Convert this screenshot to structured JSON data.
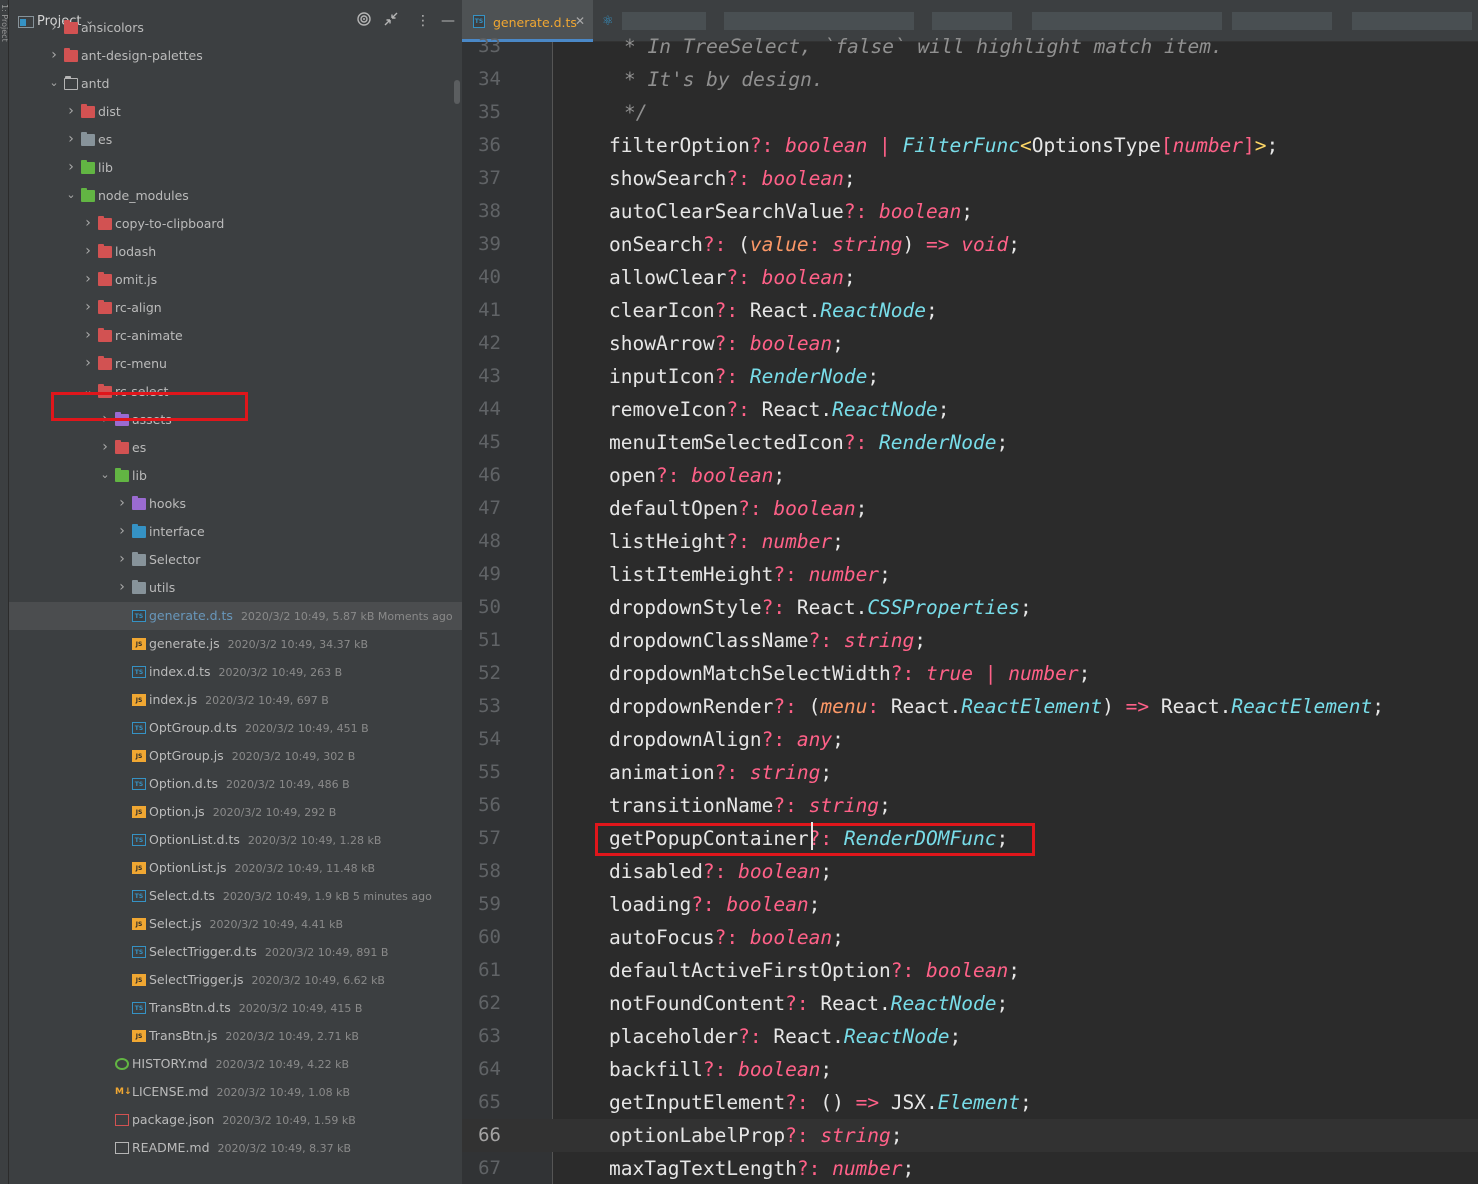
{
  "project_panel": {
    "title": "Project",
    "strip_label": "1: Project",
    "tree": [
      {
        "label": "ansicolors",
        "depth": 2,
        "kind": "folder",
        "color": "red",
        "expanded": false
      },
      {
        "label": "ant-design-palettes",
        "depth": 2,
        "kind": "folder",
        "color": "red",
        "expanded": false
      },
      {
        "label": "antd",
        "depth": 2,
        "kind": "folder",
        "color": "outline",
        "expanded": true
      },
      {
        "label": "dist",
        "depth": 3,
        "kind": "folder",
        "color": "red",
        "expanded": false
      },
      {
        "label": "es",
        "depth": 3,
        "kind": "folder",
        "color": "gray",
        "expanded": false
      },
      {
        "label": "lib",
        "depth": 3,
        "kind": "folder",
        "color": "green",
        "expanded": false
      },
      {
        "label": "node_modules",
        "depth": 3,
        "kind": "folder",
        "color": "green",
        "expanded": true
      },
      {
        "label": "copy-to-clipboard",
        "depth": 4,
        "kind": "folder",
        "color": "red",
        "expanded": false
      },
      {
        "label": "lodash",
        "depth": 4,
        "kind": "folder",
        "color": "red",
        "expanded": false
      },
      {
        "label": "omit.js",
        "depth": 4,
        "kind": "folder",
        "color": "red",
        "expanded": false
      },
      {
        "label": "rc-align",
        "depth": 4,
        "kind": "folder",
        "color": "red",
        "expanded": false
      },
      {
        "label": "rc-animate",
        "depth": 4,
        "kind": "folder",
        "color": "red",
        "expanded": false
      },
      {
        "label": "rc-menu",
        "depth": 4,
        "kind": "folder",
        "color": "red",
        "expanded": false
      },
      {
        "label": "rc-select",
        "depth": 4,
        "kind": "folder",
        "color": "red",
        "expanded": true
      },
      {
        "label": "assets",
        "depth": 5,
        "kind": "folder",
        "color": "purple",
        "expanded": false
      },
      {
        "label": "es",
        "depth": 5,
        "kind": "folder",
        "color": "red",
        "expanded": false
      },
      {
        "label": "lib",
        "depth": 5,
        "kind": "folder",
        "color": "green",
        "expanded": true
      },
      {
        "label": "hooks",
        "depth": 6,
        "kind": "folder",
        "color": "purple",
        "expanded": false
      },
      {
        "label": "interface",
        "depth": 6,
        "kind": "folder",
        "color": "blue",
        "expanded": false
      },
      {
        "label": "Selector",
        "depth": 6,
        "kind": "folder",
        "color": "gray",
        "expanded": false
      },
      {
        "label": "utils",
        "depth": 6,
        "kind": "folder",
        "color": "gray",
        "expanded": false
      },
      {
        "label": "generate.d.ts",
        "depth": 6,
        "kind": "ts",
        "meta": "2020/3/2 10:49, 5.87 kB Moments ago",
        "selected": true
      },
      {
        "label": "generate.js",
        "depth": 6,
        "kind": "js",
        "meta": "2020/3/2 10:49, 34.37 kB"
      },
      {
        "label": "index.d.ts",
        "depth": 6,
        "kind": "ts",
        "meta": "2020/3/2 10:49, 263 B"
      },
      {
        "label": "index.js",
        "depth": 6,
        "kind": "js",
        "meta": "2020/3/2 10:49, 697 B"
      },
      {
        "label": "OptGroup.d.ts",
        "depth": 6,
        "kind": "ts",
        "meta": "2020/3/2 10:49, 451 B"
      },
      {
        "label": "OptGroup.js",
        "depth": 6,
        "kind": "js",
        "meta": "2020/3/2 10:49, 302 B"
      },
      {
        "label": "Option.d.ts",
        "depth": 6,
        "kind": "ts",
        "meta": "2020/3/2 10:49, 486 B"
      },
      {
        "label": "Option.js",
        "depth": 6,
        "kind": "js",
        "meta": "2020/3/2 10:49, 292 B"
      },
      {
        "label": "OptionList.d.ts",
        "depth": 6,
        "kind": "ts",
        "meta": "2020/3/2 10:49, 1.28 kB"
      },
      {
        "label": "OptionList.js",
        "depth": 6,
        "kind": "js",
        "meta": "2020/3/2 10:49, 11.48 kB"
      },
      {
        "label": "Select.d.ts",
        "depth": 6,
        "kind": "ts",
        "meta": "2020/3/2 10:49, 1.9 kB 5 minutes ago"
      },
      {
        "label": "Select.js",
        "depth": 6,
        "kind": "js",
        "meta": "2020/3/2 10:49, 4.41 kB"
      },
      {
        "label": "SelectTrigger.d.ts",
        "depth": 6,
        "kind": "ts",
        "meta": "2020/3/2 10:49, 891 B"
      },
      {
        "label": "SelectTrigger.js",
        "depth": 6,
        "kind": "js",
        "meta": "2020/3/2 10:49, 6.62 kB"
      },
      {
        "label": "TransBtn.d.ts",
        "depth": 6,
        "kind": "ts",
        "meta": "2020/3/2 10:49, 415 B"
      },
      {
        "label": "TransBtn.js",
        "depth": 6,
        "kind": "js",
        "meta": "2020/3/2 10:49, 2.71 kB"
      },
      {
        "label": "HISTORY.md",
        "depth": 5,
        "kind": "history",
        "meta": "2020/3/2 10:49, 4.22 kB"
      },
      {
        "label": "LICENSE.md",
        "depth": 5,
        "kind": "md",
        "meta": "2020/3/2 10:49, 1.08 kB"
      },
      {
        "label": "package.json",
        "depth": 5,
        "kind": "json",
        "meta": "2020/3/2 10:49, 1.59 kB"
      },
      {
        "label": "README.md",
        "depth": 5,
        "kind": "readme",
        "meta": "2020/3/2 10:49, 8.37 kB"
      }
    ]
  },
  "editor": {
    "active_tab": {
      "label": "generate.d.ts",
      "icon_text": "TS"
    },
    "current_line": 66,
    "highlighted_line": 57,
    "lines": [
      {
        "n": 33,
        "comment": "* In TreeSelect, `false` will highlight match item."
      },
      {
        "n": 34,
        "comment": "* It's by design."
      },
      {
        "n": 35,
        "comment": "*/"
      },
      {
        "n": 36,
        "tokens": [
          [
            "ident",
            "filterOption"
          ],
          [
            "op",
            "?: "
          ],
          [
            "type",
            "boolean"
          ],
          [
            "op",
            " | "
          ],
          [
            "ref",
            "FilterFunc"
          ],
          [
            "bracket",
            "<"
          ],
          [
            "pt",
            "OptionsType"
          ],
          [
            "op",
            "["
          ],
          [
            "type",
            "number"
          ],
          [
            "op",
            "]"
          ],
          [
            "bracket",
            ">"
          ],
          [
            "punct",
            ";"
          ]
        ]
      },
      {
        "n": 37,
        "tokens": [
          [
            "ident",
            "showSearch"
          ],
          [
            "op",
            "?: "
          ],
          [
            "type",
            "boolean"
          ],
          [
            "punct",
            ";"
          ]
        ]
      },
      {
        "n": 38,
        "tokens": [
          [
            "ident",
            "autoClearSearchValue"
          ],
          [
            "op",
            "?: "
          ],
          [
            "type",
            "boolean"
          ],
          [
            "punct",
            ";"
          ]
        ]
      },
      {
        "n": 39,
        "tokens": [
          [
            "ident",
            "onSearch"
          ],
          [
            "op",
            "?: "
          ],
          [
            "punct",
            "("
          ],
          [
            "param",
            "value"
          ],
          [
            "op",
            ": "
          ],
          [
            "type",
            "string"
          ],
          [
            "punct",
            ")"
          ],
          [
            "op",
            " => "
          ],
          [
            "type",
            "void"
          ],
          [
            "punct",
            ";"
          ]
        ]
      },
      {
        "n": 40,
        "tokens": [
          [
            "ident",
            "allowClear"
          ],
          [
            "op",
            "?: "
          ],
          [
            "type",
            "boolean"
          ],
          [
            "punct",
            ";"
          ]
        ]
      },
      {
        "n": 41,
        "tokens": [
          [
            "ident",
            "clearIcon"
          ],
          [
            "op",
            "?: "
          ],
          [
            "react",
            "React"
          ],
          [
            "punct",
            "."
          ],
          [
            "ref",
            "ReactNode"
          ],
          [
            "punct",
            ";"
          ]
        ]
      },
      {
        "n": 42,
        "tokens": [
          [
            "ident",
            "showArrow"
          ],
          [
            "op",
            "?: "
          ],
          [
            "type",
            "boolean"
          ],
          [
            "punct",
            ";"
          ]
        ]
      },
      {
        "n": 43,
        "tokens": [
          [
            "ident",
            "inputIcon"
          ],
          [
            "op",
            "?: "
          ],
          [
            "ref",
            "RenderNode"
          ],
          [
            "punct",
            ";"
          ]
        ]
      },
      {
        "n": 44,
        "tokens": [
          [
            "ident",
            "removeIcon"
          ],
          [
            "op",
            "?: "
          ],
          [
            "react",
            "React"
          ],
          [
            "punct",
            "."
          ],
          [
            "ref",
            "ReactNode"
          ],
          [
            "punct",
            ";"
          ]
        ]
      },
      {
        "n": 45,
        "tokens": [
          [
            "ident",
            "menuItemSelectedIcon"
          ],
          [
            "op",
            "?: "
          ],
          [
            "ref",
            "RenderNode"
          ],
          [
            "punct",
            ";"
          ]
        ]
      },
      {
        "n": 46,
        "tokens": [
          [
            "ident",
            "open"
          ],
          [
            "op",
            "?: "
          ],
          [
            "type",
            "boolean"
          ],
          [
            "punct",
            ";"
          ]
        ]
      },
      {
        "n": 47,
        "tokens": [
          [
            "ident",
            "defaultOpen"
          ],
          [
            "op",
            "?: "
          ],
          [
            "type",
            "boolean"
          ],
          [
            "punct",
            ";"
          ]
        ]
      },
      {
        "n": 48,
        "tokens": [
          [
            "ident",
            "listHeight"
          ],
          [
            "op",
            "?: "
          ],
          [
            "type",
            "number"
          ],
          [
            "punct",
            ";"
          ]
        ]
      },
      {
        "n": 49,
        "tokens": [
          [
            "ident",
            "listItemHeight"
          ],
          [
            "op",
            "?: "
          ],
          [
            "type",
            "number"
          ],
          [
            "punct",
            ";"
          ]
        ]
      },
      {
        "n": 50,
        "tokens": [
          [
            "ident",
            "dropdownStyle"
          ],
          [
            "op",
            "?: "
          ],
          [
            "react",
            "React"
          ],
          [
            "punct",
            "."
          ],
          [
            "ref",
            "CSSProperties"
          ],
          [
            "punct",
            ";"
          ]
        ]
      },
      {
        "n": 51,
        "tokens": [
          [
            "ident",
            "dropdownClassName"
          ],
          [
            "op",
            "?: "
          ],
          [
            "type",
            "string"
          ],
          [
            "punct",
            ";"
          ]
        ]
      },
      {
        "n": 52,
        "tokens": [
          [
            "ident",
            "dropdownMatchSelectWidth"
          ],
          [
            "op",
            "?: "
          ],
          [
            "type",
            "true"
          ],
          [
            "op",
            " | "
          ],
          [
            "type",
            "number"
          ],
          [
            "punct",
            ";"
          ]
        ]
      },
      {
        "n": 53,
        "tokens": [
          [
            "ident",
            "dropdownRender"
          ],
          [
            "op",
            "?: "
          ],
          [
            "punct",
            "("
          ],
          [
            "param",
            "menu"
          ],
          [
            "op",
            ": "
          ],
          [
            "react",
            "React"
          ],
          [
            "punct",
            "."
          ],
          [
            "ref",
            "ReactElement"
          ],
          [
            "punct",
            ")"
          ],
          [
            "op",
            " => "
          ],
          [
            "react",
            "React"
          ],
          [
            "punct",
            "."
          ],
          [
            "ref",
            "ReactElement"
          ],
          [
            "punct",
            ";"
          ]
        ]
      },
      {
        "n": 54,
        "tokens": [
          [
            "ident",
            "dropdownAlign"
          ],
          [
            "op",
            "?: "
          ],
          [
            "type",
            "any"
          ],
          [
            "punct",
            ";"
          ]
        ]
      },
      {
        "n": 55,
        "tokens": [
          [
            "ident",
            "animation"
          ],
          [
            "op",
            "?: "
          ],
          [
            "type",
            "string"
          ],
          [
            "punct",
            ";"
          ]
        ]
      },
      {
        "n": 56,
        "tokens": [
          [
            "ident",
            "transitionName"
          ],
          [
            "op",
            "?: "
          ],
          [
            "type",
            "string"
          ],
          [
            "punct",
            ";"
          ]
        ]
      },
      {
        "n": 57,
        "tokens": [
          [
            "ident",
            "getPopupContainer"
          ],
          [
            "op",
            "?: "
          ],
          [
            "ref",
            "RenderDOMFunc"
          ],
          [
            "punct",
            ";"
          ]
        ]
      },
      {
        "n": 58,
        "tokens": [
          [
            "ident",
            "disabled"
          ],
          [
            "op",
            "?: "
          ],
          [
            "type",
            "boolean"
          ],
          [
            "punct",
            ";"
          ]
        ]
      },
      {
        "n": 59,
        "tokens": [
          [
            "ident",
            "loading"
          ],
          [
            "op",
            "?: "
          ],
          [
            "type",
            "boolean"
          ],
          [
            "punct",
            ";"
          ]
        ]
      },
      {
        "n": 60,
        "tokens": [
          [
            "ident",
            "autoFocus"
          ],
          [
            "op",
            "?: "
          ],
          [
            "type",
            "boolean"
          ],
          [
            "punct",
            ";"
          ]
        ]
      },
      {
        "n": 61,
        "tokens": [
          [
            "ident",
            "defaultActiveFirstOption"
          ],
          [
            "op",
            "?: "
          ],
          [
            "type",
            "boolean"
          ],
          [
            "punct",
            ";"
          ]
        ]
      },
      {
        "n": 62,
        "tokens": [
          [
            "ident",
            "notFoundContent"
          ],
          [
            "op",
            "?: "
          ],
          [
            "react",
            "React"
          ],
          [
            "punct",
            "."
          ],
          [
            "ref",
            "ReactNode"
          ],
          [
            "punct",
            ";"
          ]
        ]
      },
      {
        "n": 63,
        "tokens": [
          [
            "ident",
            "placeholder"
          ],
          [
            "op",
            "?: "
          ],
          [
            "react",
            "React"
          ],
          [
            "punct",
            "."
          ],
          [
            "ref",
            "ReactNode"
          ],
          [
            "punct",
            ";"
          ]
        ]
      },
      {
        "n": 64,
        "tokens": [
          [
            "ident",
            "backfill"
          ],
          [
            "op",
            "?: "
          ],
          [
            "type",
            "boolean"
          ],
          [
            "punct",
            ";"
          ]
        ]
      },
      {
        "n": 65,
        "tokens": [
          [
            "ident",
            "getInputElement"
          ],
          [
            "op",
            "?: "
          ],
          [
            "punct",
            "() "
          ],
          [
            "op",
            "=> "
          ],
          [
            "react",
            "JSX"
          ],
          [
            "punct",
            "."
          ],
          [
            "ref",
            "Element"
          ],
          [
            "punct",
            ";"
          ]
        ]
      },
      {
        "n": 66,
        "tokens": [
          [
            "ident",
            "optionLabelProp"
          ],
          [
            "op",
            "?: "
          ],
          [
            "type",
            "string"
          ],
          [
            "punct",
            ";"
          ]
        ]
      },
      {
        "n": 67,
        "tokens": [
          [
            "ident",
            "maxTagTextLength"
          ],
          [
            "op",
            "?: "
          ],
          [
            "type",
            "number"
          ],
          [
            "punct",
            ";"
          ]
        ]
      }
    ]
  },
  "colors": {
    "accent_tab": "#4a88c7",
    "highlight_box": "#e0161b",
    "keyword_pink": "#ff6188",
    "type_cyan": "#78dce8",
    "param_orange": "#fc9867",
    "bracket_yellow": "#ffd866"
  },
  "icons": {
    "project": "project-folder-icon",
    "locate": "target-icon",
    "collapse": "collapse-arrows-icon",
    "menu": "vertical-dots-icon",
    "hide": "minimize-icon"
  }
}
